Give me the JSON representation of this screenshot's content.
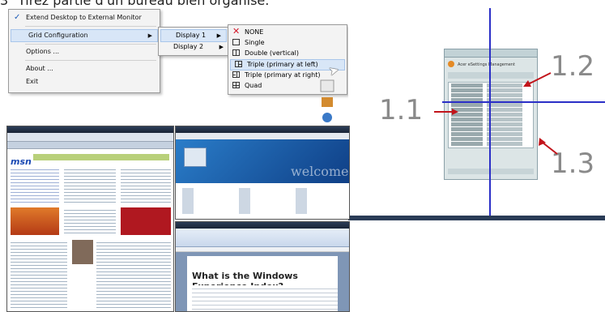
{
  "heading": {
    "number": "3",
    "text": "Tirez partie d'un bureau bien organisé."
  },
  "context_menu": {
    "items": [
      {
        "label": "Extend Desktop to External Monitor",
        "checked": true
      },
      {
        "label": "Grid Configuration",
        "has_submenu": true
      },
      {
        "label": "Options ..."
      },
      {
        "label": "About ..."
      },
      {
        "label": "Exit"
      }
    ],
    "displays": [
      "Display 1",
      "Display 2"
    ],
    "layouts": [
      {
        "label": "NONE",
        "icon": "none-x-icon"
      },
      {
        "label": "Single",
        "icon": "single-icon"
      },
      {
        "label": "Double (vertical)",
        "icon": "double-vertical-icon"
      },
      {
        "label": "Triple (primary at left)",
        "icon": "triple-left-icon",
        "highlighted": true
      },
      {
        "label": "Triple (primary at right)",
        "icon": "triple-right-icon"
      },
      {
        "label": "Quad",
        "icon": "quad-icon"
      }
    ]
  },
  "diagram": {
    "labels": [
      "1.1",
      "1.2",
      "1.3"
    ],
    "window_title": "Acer eSettings Management",
    "line_color": "#2b2fc7",
    "arrow_color": "#c2141b"
  },
  "screens": {
    "browser": {
      "logo": "msn"
    },
    "welcome": {
      "text": "welcome"
    },
    "document": {
      "title": "What is the Windows Experience Index?"
    }
  }
}
